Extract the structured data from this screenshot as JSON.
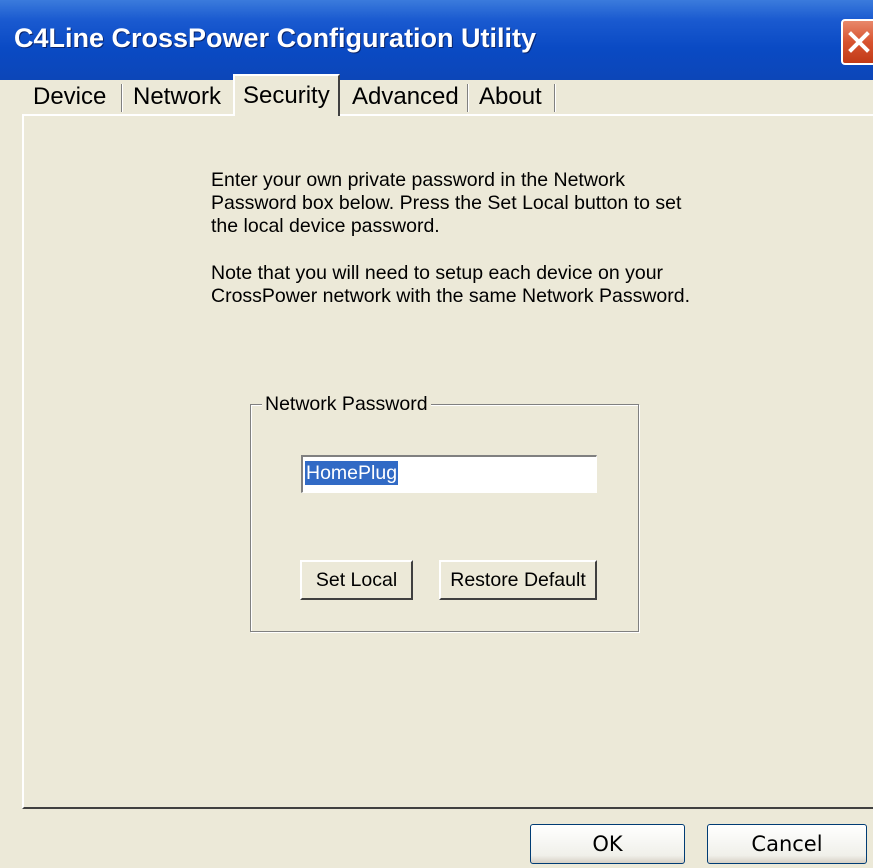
{
  "window": {
    "title": "C4Line CrossPower Configuration Utility",
    "close_icon": "close-icon"
  },
  "tabs": [
    {
      "label": "Device",
      "active": false
    },
    {
      "label": "Network",
      "active": false
    },
    {
      "label": "Security",
      "active": true
    },
    {
      "label": "Advanced",
      "active": false
    },
    {
      "label": "About",
      "active": false
    }
  ],
  "security": {
    "instructions_1": "Enter your own private password in the Network Password box below. Press the Set Local button to set the local device password.",
    "instructions_2": "Note that you will need to setup each device on your CrossPower network with the same Network Password.",
    "group_label": "Network Password",
    "password_value": "HomePlug",
    "set_local_label": "Set Local",
    "restore_default_label": "Restore Default"
  },
  "footer": {
    "ok_label": "OK",
    "cancel_label": "Cancel"
  },
  "colors": {
    "titlebar": "#0a4ac4",
    "face": "#ece9d8",
    "close": "#d8532f",
    "selection": "#316ac5"
  }
}
